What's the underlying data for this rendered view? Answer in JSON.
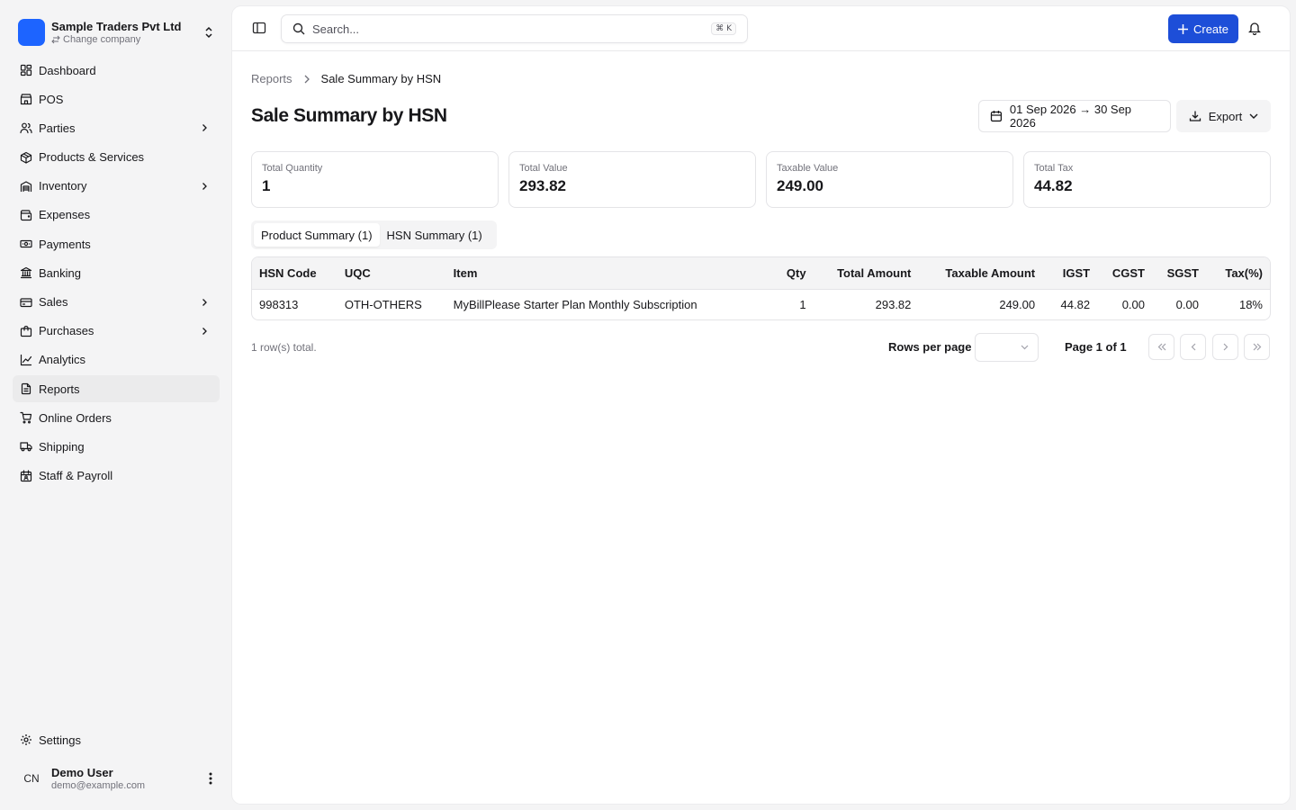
{
  "sidebar": {
    "company": {
      "name": "Sample Traders Pvt Ltd",
      "sub": "Change company"
    },
    "items": [
      {
        "label": "Dashboard",
        "icon": "dashboard-icon"
      },
      {
        "label": "POS",
        "icon": "store-icon"
      },
      {
        "label": "Parties",
        "icon": "users-icon",
        "expandable": true
      },
      {
        "label": "Products & Services",
        "icon": "package-icon"
      },
      {
        "label": "Inventory",
        "icon": "warehouse-icon",
        "expandable": true
      },
      {
        "label": "Expenses",
        "icon": "wallet-icon"
      },
      {
        "label": "Payments",
        "icon": "banknote-icon"
      },
      {
        "label": "Banking",
        "icon": "bank-icon"
      },
      {
        "label": "Sales",
        "icon": "credit-card-icon",
        "expandable": true
      },
      {
        "label": "Purchases",
        "icon": "shopping-bag-icon",
        "expandable": true
      },
      {
        "label": "Analytics",
        "icon": "chart-line-icon"
      },
      {
        "label": "Reports",
        "icon": "file-text-icon",
        "active": true
      },
      {
        "label": "Online Orders",
        "icon": "cart-icon"
      },
      {
        "label": "Shipping",
        "icon": "truck-icon"
      },
      {
        "label": "Staff & Payroll",
        "icon": "calendar-user-icon"
      }
    ],
    "settings_label": "Settings",
    "user": {
      "initials": "CN",
      "name": "Demo User",
      "email": "demo@example.com"
    }
  },
  "topbar": {
    "search_placeholder": "Search...",
    "shortcut": "⌘ K",
    "create_label": "Create"
  },
  "breadcrumb": {
    "parent": "Reports",
    "current": "Sale Summary by HSN"
  },
  "page": {
    "title": "Sale Summary by HSN",
    "date_range": "01 Sep 2026 → 30 Sep 2026",
    "export_label": "Export"
  },
  "summary": [
    {
      "label": "Total Quantity",
      "value": "1"
    },
    {
      "label": "Total Value",
      "value": "293.82"
    },
    {
      "label": "Taxable Value",
      "value": "249.00"
    },
    {
      "label": "Total Tax",
      "value": "44.82"
    }
  ],
  "tabs": [
    {
      "label": "Product Summary (1)",
      "active": true
    },
    {
      "label": "HSN Summary (1)",
      "active": false
    }
  ],
  "table": {
    "headers": [
      "HSN Code",
      "UQC",
      "Item",
      "Qty",
      "Total Amount",
      "Taxable Amount",
      "IGST",
      "CGST",
      "SGST",
      "Tax(%)"
    ],
    "rows": [
      [
        "998313",
        "OTH-OTHERS",
        "MyBillPlease Starter Plan Monthly Subscription",
        "1",
        "293.82",
        "249.00",
        "44.82",
        "0.00",
        "0.00",
        "18%"
      ]
    ]
  },
  "pagination": {
    "rows_total": "1 row(s) total.",
    "rows_per_page_label": "Rows per page",
    "page_info": "Page 1 of 1"
  },
  "colors": {
    "accent": "#1d4ed8",
    "logo": "#1d64ff"
  }
}
